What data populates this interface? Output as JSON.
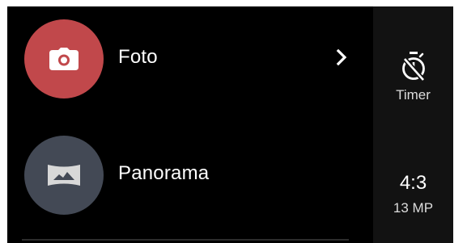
{
  "modes": [
    {
      "label": "Foto",
      "icon": "camera-icon",
      "color": "#c1484b"
    },
    {
      "label": "Panorama",
      "icon": "panorama-icon",
      "color": "#434955"
    }
  ],
  "side_panel": {
    "timer": {
      "label": "Timer",
      "icon": "timer-off-icon"
    },
    "aspect": {
      "ratio": "4:3",
      "resolution": "13 MP"
    }
  },
  "colors": {
    "background": "#000000",
    "side_panel": "#121212",
    "text": "#ffffff"
  }
}
